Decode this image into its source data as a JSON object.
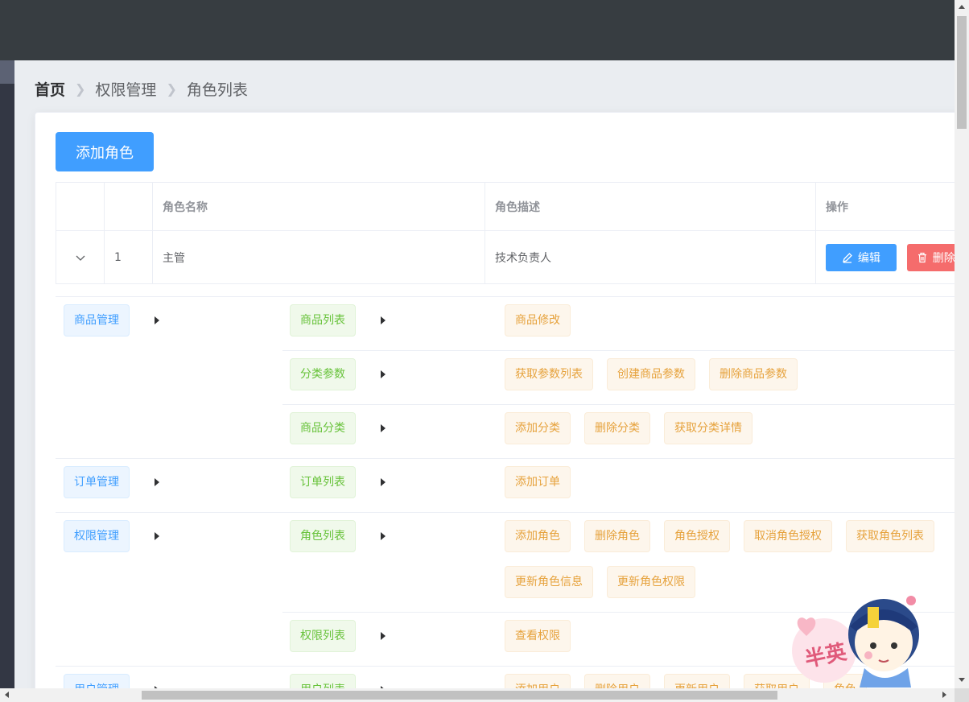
{
  "breadcrumb": [
    "首页",
    "权限管理",
    "角色列表"
  ],
  "add_button": "添加角色",
  "table": {
    "headers": [
      "",
      "",
      "角色名称",
      "角色描述",
      "操作"
    ],
    "row": {
      "index": "1",
      "name": "主管",
      "desc": "技术负责人",
      "edit": "编辑",
      "delete": "删除"
    }
  },
  "rights": [
    {
      "label": "商品管理",
      "children": [
        {
          "label": "商品列表",
          "children": [
            "商品修改"
          ]
        },
        {
          "label": "分类参数",
          "children": [
            "获取参数列表",
            "创建商品参数",
            "删除商品参数"
          ]
        },
        {
          "label": "商品分类",
          "children": [
            "添加分类",
            "删除分类",
            "获取分类详情"
          ]
        }
      ]
    },
    {
      "label": "订单管理",
      "children": [
        {
          "label": "订单列表",
          "children": [
            "添加订单"
          ]
        }
      ]
    },
    {
      "label": "权限管理",
      "children": [
        {
          "label": "角色列表",
          "children": [
            "添加角色",
            "删除角色",
            "角色授权",
            "取消角色授权",
            "获取角色列表",
            "更新角色信息",
            "更新角色权限"
          ]
        },
        {
          "label": "权限列表",
          "children": [
            "查看权限"
          ]
        }
      ]
    },
    {
      "label": "用户管理",
      "children": [
        {
          "label": "用户列表",
          "children": [
            "添加用户",
            "删除用户",
            "更新用户",
            "获取用户",
            "角色"
          ]
        }
      ]
    }
  ],
  "watermark": "半英",
  "colors": {
    "primary": "#409eff",
    "danger": "#f56c6c",
    "success": "#67c23a",
    "warning": "#e6a23c",
    "header": "#373d41",
    "aside": "#333744"
  }
}
